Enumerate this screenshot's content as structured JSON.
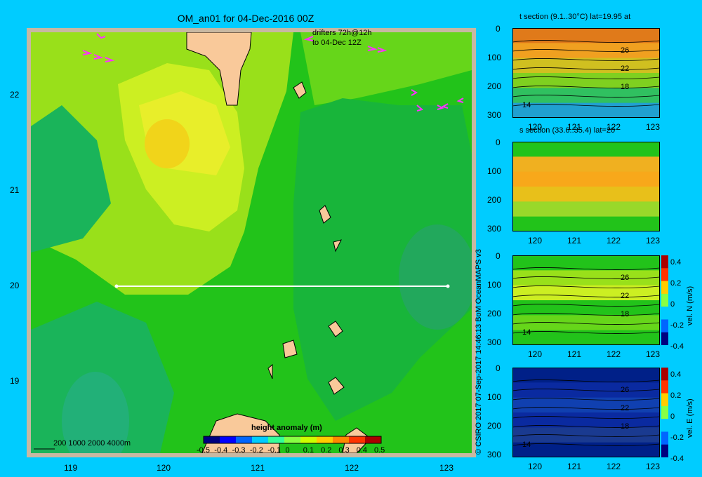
{
  "map": {
    "title": "OM_an01 for 04-Dec-2016 00Z",
    "drifter_note_1": "drifters 72h@12h",
    "drifter_note_2": "to 04-Dec 12Z",
    "x_ticks": [
      "119",
      "120",
      "121",
      "122",
      "123"
    ],
    "y_ticks": [
      "22",
      "21",
      "20",
      "19"
    ],
    "depth_legend": "200  1000  2000  4000m",
    "colorbar_title": "height anomaly  (m)",
    "colorbar_ticks": [
      "-0.5",
      "-0.4",
      "-0.3",
      "-0.2",
      "-0.1",
      "0",
      "0.1",
      "0.2",
      "0.3",
      "0.4",
      "0.5"
    ],
    "colors": {
      "background": "#00ccff",
      "land": "#f9c99a",
      "frame": "#c8b8a2",
      "drifter": "#ff33ff",
      "section_line": "#ffffff"
    }
  },
  "credit": "© CSIRO 2017   07-Sep-2017 14:46:13 BoM OceanMAPS v3",
  "panels": [
    {
      "title": "t section (9.1..30°C) lat=19.95 at",
      "x_ticks": [
        "120",
        "121",
        "122",
        "123"
      ],
      "y_ticks": [
        "0",
        "100",
        "200",
        "300"
      ],
      "contour_labels": [
        "26",
        "22",
        "18",
        "14"
      ]
    },
    {
      "title": "s section (33.6..35.4) lat=20",
      "x_ticks": [
        "120",
        "121",
        "122",
        "123"
      ],
      "y_ticks": [
        "0",
        "100",
        "200",
        "300"
      ],
      "contour_labels": []
    },
    {
      "title": "",
      "x_ticks": [
        "120",
        "121",
        "122",
        "123"
      ],
      "y_ticks": [
        "0",
        "100",
        "200",
        "300"
      ],
      "contour_labels": [
        "26",
        "22",
        "18",
        "14"
      ],
      "colorbar_ticks": [
        "0.4",
        "0.2",
        "0",
        "-0.2",
        "-0.4"
      ],
      "colorbar_label": "vel. N  (m/s)"
    },
    {
      "title": "",
      "x_ticks": [
        "120",
        "121",
        "122",
        "123"
      ],
      "y_ticks": [
        "0",
        "100",
        "200",
        "300"
      ],
      "contour_labels": [
        "26",
        "22",
        "18",
        "14"
      ],
      "colorbar_ticks": [
        "0.4",
        "0.2",
        "0",
        "-0.2",
        "-0.4"
      ],
      "colorbar_label": "vel. E  (m/s)"
    }
  ],
  "chart_data": [
    {
      "type": "heatmap",
      "title": "OM_an01 for 04-Dec-2016 00Z",
      "xlim": [
        118.5,
        123.5
      ],
      "ylim": [
        18.25,
        22.7
      ],
      "colorbar": "height anomaly  (m)",
      "clim": [
        -0.5,
        0.5
      ],
      "section_line": {
        "lat": 20,
        "lon": [
          119.5,
          123.2
        ]
      }
    },
    {
      "type": "heatmap",
      "title": "t section (9.1..30°C) lat=19.95 at",
      "xlim": [
        119.6,
        123.2
      ],
      "ylim": [
        300,
        0
      ]
    },
    {
      "type": "heatmap",
      "title": "s section (33.6..35.4) lat=20",
      "xlim": [
        119.6,
        123.2
      ],
      "ylim": [
        300,
        0
      ]
    },
    {
      "type": "heatmap",
      "colorbar": "vel. N  (m/s)",
      "clim": [
        -0.4,
        0.4
      ],
      "xlim": [
        119.6,
        123.2
      ],
      "ylim": [
        300,
        0
      ]
    },
    {
      "type": "heatmap",
      "colorbar": "vel. E  (m/s)",
      "clim": [
        -0.4,
        0.4
      ],
      "xlim": [
        119.6,
        123.2
      ],
      "ylim": [
        300,
        0
      ]
    }
  ]
}
